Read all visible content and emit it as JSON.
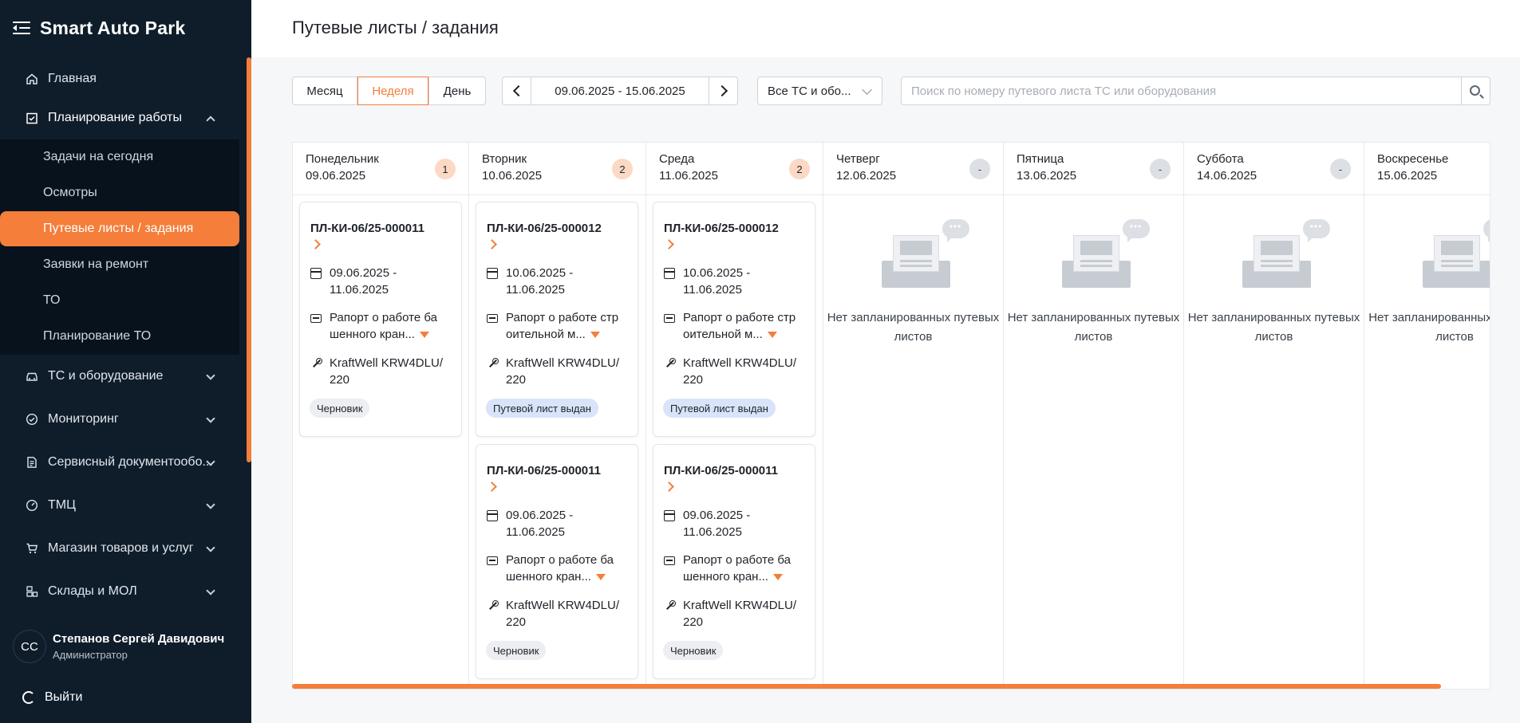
{
  "app": {
    "title": "Smart Auto Park"
  },
  "sidebar": {
    "items": [
      {
        "label": "Главная",
        "icon": "home-icon"
      },
      {
        "label": "Планирование работы",
        "icon": "checklist-icon",
        "expanded": true
      },
      {
        "label": "ТС и оборудование",
        "icon": "car-icon"
      },
      {
        "label": "Мониторинг",
        "icon": "monitoring-icon"
      },
      {
        "label": "Сервисный документообо...",
        "icon": "document-icon"
      },
      {
        "label": "ТМЦ",
        "icon": "gauge-icon"
      },
      {
        "label": "Магазин товаров и услуг",
        "icon": "cart-icon"
      },
      {
        "label": "Склады и МОЛ",
        "icon": "warehouse-icon"
      }
    ],
    "submenu": [
      {
        "label": "Задачи на сегодня"
      },
      {
        "label": "Осмотры"
      },
      {
        "label": "Путевые листы / задания",
        "active": true
      },
      {
        "label": "Заявки на ремонт"
      },
      {
        "label": "ТО"
      },
      {
        "label": "Планирование ТО"
      }
    ],
    "user": {
      "initials": "СС",
      "name": "Степанов Сергей Давидович",
      "role": "Администратор"
    },
    "logout": "Выйти"
  },
  "header": {
    "title": "Путевые листы / задания"
  },
  "toolbar": {
    "views": [
      "Месяц",
      "Неделя",
      "День"
    ],
    "active_view": "Неделя",
    "date_range": "09.06.2025 - 15.06.2025",
    "vehicle_filter": "Все ТС и обо...",
    "search_placeholder": "Поиск по номеру путевого листа ТС или оборудования"
  },
  "calendar": {
    "days": [
      {
        "day": "Понедельник",
        "date": "09.06.2025",
        "count": "1",
        "cards": [
          {
            "number": "ПЛ-КИ-06/25-000011",
            "period": "09.06.2025 - 11.06.2025",
            "report": "Рапорт о работе ба шенного кран...",
            "equipment": "KraftWell KRW4DLU/ 220",
            "status": "Черновик",
            "status_type": "draft"
          }
        ]
      },
      {
        "day": "Вторник",
        "date": "10.06.2025",
        "count": "2",
        "cards": [
          {
            "number": "ПЛ-КИ-06/25-000012",
            "period": "10.06.2025 - 11.06.2025",
            "report": "Рапорт о работе стр оительной м...",
            "equipment": "KraftWell KRW4DLU/ 220",
            "status": "Путевой лист выдан",
            "status_type": "issued"
          },
          {
            "number": "ПЛ-КИ-06/25-000011",
            "period": "09.06.2025 - 11.06.2025",
            "report": "Рапорт о работе ба шенного кран...",
            "equipment": "KraftWell KRW4DLU/ 220",
            "status": "Черновик",
            "status_type": "draft"
          }
        ]
      },
      {
        "day": "Среда",
        "date": "11.06.2025",
        "count": "2",
        "cards": [
          {
            "number": "ПЛ-КИ-06/25-000012",
            "period": "10.06.2025 - 11.06.2025",
            "report": "Рапорт о работе стр оительной м...",
            "equipment": "KraftWell KRW4DLU/ 220",
            "status": "Путевой лист выдан",
            "status_type": "issued"
          },
          {
            "number": "ПЛ-КИ-06/25-000011",
            "period": "09.06.2025 - 11.06.2025",
            "report": "Рапорт о работе ба шенного кран...",
            "equipment": "KraftWell KRW4DLU/ 220",
            "status": "Черновик",
            "status_type": "draft"
          }
        ]
      },
      {
        "day": "Четверг",
        "date": "12.06.2025",
        "count": "-",
        "empty": "Нет запланированных путевых листов",
        "cards": []
      },
      {
        "day": "Пятница",
        "date": "13.06.2025",
        "count": "-",
        "empty": "Нет запланированных путевых листов",
        "cards": []
      },
      {
        "day": "Суббота",
        "date": "14.06.2025",
        "count": "-",
        "empty": "Нет запланированных путевых листов",
        "cards": []
      },
      {
        "day": "Воскресенье",
        "date": "15.06.2025",
        "count": "",
        "empty": "Нет запланированных путевых листов",
        "cards": []
      }
    ]
  },
  "colors": {
    "accent": "#f47e3a",
    "sidebar_bg": "#0f1d2b",
    "submenu_bg": "#07121c",
    "issued_badge": "#d9e4fb",
    "draft_badge": "#eceef1"
  }
}
